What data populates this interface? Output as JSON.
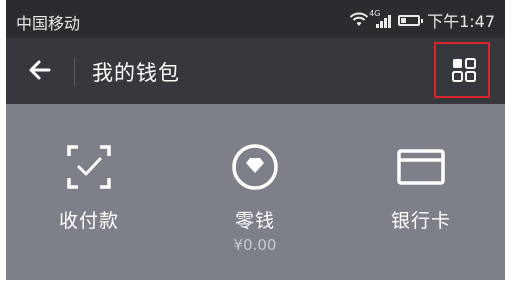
{
  "statusbar": {
    "carrier": "中国移动",
    "network": "4G",
    "time": "下午1:47"
  },
  "navbar": {
    "title": "我的钱包",
    "back_icon": "back-arrow-icon",
    "menu_icon": "grid-menu-icon",
    "highlight_color": "#d9262c"
  },
  "wallet": {
    "items": [
      {
        "label": "收付款",
        "icon": "scan-pay-icon"
      },
      {
        "label": "零钱",
        "icon": "change-coin-icon",
        "amount": "¥0.00"
      },
      {
        "label": "银行卡",
        "icon": "bank-card-icon"
      }
    ]
  },
  "colors": {
    "statusbar": "#2b2c30",
    "navbar": "#37383d",
    "panel": "#7d8089",
    "text": "#ffffff"
  }
}
